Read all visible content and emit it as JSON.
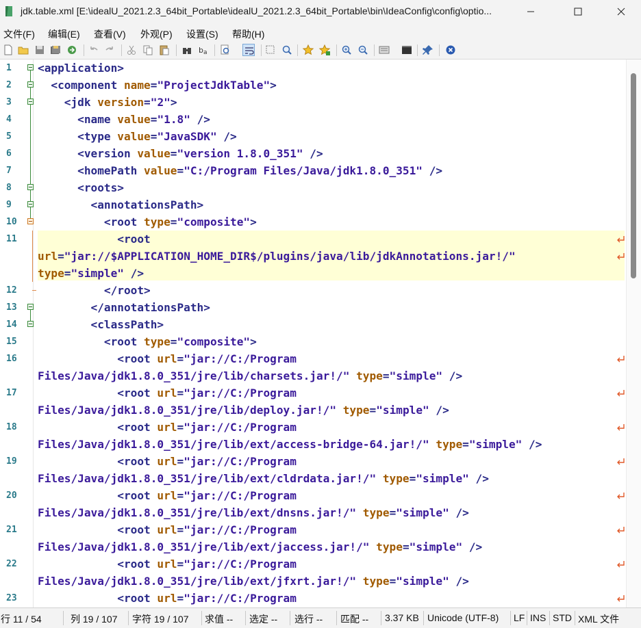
{
  "window": {
    "title": "jdk.table.xml [E:\\idealU_2021.2.3_64bit_Portable\\idealU_2021.2.3_64bit_Portable\\bin\\IdeaConfig\\config\\optio..."
  },
  "menu": [
    "文件(F)",
    "编辑(E)",
    "查看(V)",
    "外观(P)",
    "设置(S)",
    "帮助(H)"
  ],
  "toolbar_icons": [
    "new-file-icon",
    "open-folder-icon",
    "save-icon",
    "save-all-icon",
    "browse-icon",
    "undo-icon",
    "redo-icon",
    "cut-icon",
    "copy-icon",
    "paste-icon",
    "find-icon",
    "replace-icon",
    "find-in-files-icon",
    "word-wrap-icon",
    "select-all-icon",
    "zoom-find-icon",
    "favorite-icon",
    "add-favorite-icon",
    "zoom-in-icon",
    "zoom-out-icon",
    "view-icon",
    "console-icon",
    "pin-icon",
    "close-circle-icon"
  ],
  "lines": [
    {
      "num": "1",
      "code": [
        [
          "t",
          "<application>"
        ]
      ]
    },
    {
      "num": "2",
      "code": [
        [
          "t",
          "  <component "
        ],
        [
          "a",
          "name"
        ],
        [
          "t",
          "="
        ],
        [
          "v",
          "\"ProjectJdkTable\""
        ],
        [
          "t",
          ">"
        ]
      ]
    },
    {
      "num": "3",
      "code": [
        [
          "t",
          "    <jdk "
        ],
        [
          "a",
          "version"
        ],
        [
          "t",
          "="
        ],
        [
          "v",
          "\"2\""
        ],
        [
          "t",
          ">"
        ]
      ]
    },
    {
      "num": "4",
      "code": [
        [
          "t",
          "      <name "
        ],
        [
          "a",
          "value"
        ],
        [
          "t",
          "="
        ],
        [
          "v",
          "\"1.8\""
        ],
        [
          "t",
          " />"
        ]
      ]
    },
    {
      "num": "5",
      "code": [
        [
          "t",
          "      <type "
        ],
        [
          "a",
          "value"
        ],
        [
          "t",
          "="
        ],
        [
          "v",
          "\"JavaSDK\""
        ],
        [
          "t",
          " />"
        ]
      ]
    },
    {
      "num": "6",
      "code": [
        [
          "t",
          "      <version "
        ],
        [
          "a",
          "value"
        ],
        [
          "t",
          "="
        ],
        [
          "v",
          "\"version 1.8.0_351\""
        ],
        [
          "t",
          " />"
        ]
      ]
    },
    {
      "num": "7",
      "code": [
        [
          "t",
          "      <homePath "
        ],
        [
          "a",
          "value"
        ],
        [
          "t",
          "="
        ],
        [
          "v",
          "\"C:/Program Files/Java/jdk1.8.0_351\""
        ],
        [
          "t",
          " />"
        ]
      ]
    },
    {
      "num": "8",
      "code": [
        [
          "t",
          "      <roots>"
        ]
      ]
    },
    {
      "num": "9",
      "code": [
        [
          "t",
          "        <annotationsPath>"
        ]
      ]
    },
    {
      "num": "10",
      "code": [
        [
          "t",
          "          <root "
        ],
        [
          "a",
          "type"
        ],
        [
          "t",
          "="
        ],
        [
          "v",
          "\"composite\""
        ],
        [
          "t",
          ">"
        ]
      ]
    },
    {
      "num": "11",
      "code": [
        [
          "t",
          "            <root"
        ]
      ]
    },
    {
      "num": "",
      "code": [
        [
          "a",
          "url"
        ],
        [
          "t",
          "="
        ],
        [
          "v",
          "\"jar://$APPLICATION_HOME_DIR$/plugins/java/lib/jdkAnnotations.jar!/\""
        ]
      ]
    },
    {
      "num": "",
      "code": [
        [
          "a",
          "type"
        ],
        [
          "t",
          "="
        ],
        [
          "v",
          "\"simple\""
        ],
        [
          "t",
          " />"
        ]
      ]
    },
    {
      "num": "12",
      "code": [
        [
          "t",
          "          </root>"
        ]
      ]
    },
    {
      "num": "13",
      "code": [
        [
          "t",
          "        </annotationsPath>"
        ]
      ]
    },
    {
      "num": "14",
      "code": [
        [
          "t",
          "        <classPath>"
        ]
      ]
    },
    {
      "num": "15",
      "code": [
        [
          "t",
          "          <root "
        ],
        [
          "a",
          "type"
        ],
        [
          "t",
          "="
        ],
        [
          "v",
          "\"composite\""
        ],
        [
          "t",
          ">"
        ]
      ]
    },
    {
      "num": "16",
      "code": [
        [
          "t",
          "            <root "
        ],
        [
          "a",
          "url"
        ],
        [
          "t",
          "="
        ],
        [
          "v",
          "\"jar://C:/Program"
        ]
      ]
    },
    {
      "num": "",
      "code": [
        [
          "v",
          "Files/Java/jdk1.8.0_351/jre/lib/charsets.jar!/\""
        ],
        [
          "t",
          " "
        ],
        [
          "a",
          "type"
        ],
        [
          "t",
          "="
        ],
        [
          "v",
          "\"simple\""
        ],
        [
          "t",
          " />"
        ]
      ]
    },
    {
      "num": "17",
      "code": [
        [
          "t",
          "            <root "
        ],
        [
          "a",
          "url"
        ],
        [
          "t",
          "="
        ],
        [
          "v",
          "\"jar://C:/Program"
        ]
      ]
    },
    {
      "num": "",
      "code": [
        [
          "v",
          "Files/Java/jdk1.8.0_351/jre/lib/deploy.jar!/\""
        ],
        [
          "t",
          " "
        ],
        [
          "a",
          "type"
        ],
        [
          "t",
          "="
        ],
        [
          "v",
          "\"simple\""
        ],
        [
          "t",
          " />"
        ]
      ]
    },
    {
      "num": "18",
      "code": [
        [
          "t",
          "            <root "
        ],
        [
          "a",
          "url"
        ],
        [
          "t",
          "="
        ],
        [
          "v",
          "\"jar://C:/Program"
        ]
      ]
    },
    {
      "num": "",
      "code": [
        [
          "v",
          "Files/Java/jdk1.8.0_351/jre/lib/ext/access-bridge-64.jar!/\""
        ],
        [
          "t",
          " "
        ],
        [
          "a",
          "type"
        ],
        [
          "t",
          "="
        ],
        [
          "v",
          "\"simple\""
        ],
        [
          "t",
          " />"
        ]
      ]
    },
    {
      "num": "19",
      "code": [
        [
          "t",
          "            <root "
        ],
        [
          "a",
          "url"
        ],
        [
          "t",
          "="
        ],
        [
          "v",
          "\"jar://C:/Program"
        ]
      ]
    },
    {
      "num": "",
      "code": [
        [
          "v",
          "Files/Java/jdk1.8.0_351/jre/lib/ext/cldrdata.jar!/\""
        ],
        [
          "t",
          " "
        ],
        [
          "a",
          "type"
        ],
        [
          "t",
          "="
        ],
        [
          "v",
          "\"simple\""
        ],
        [
          "t",
          " />"
        ]
      ]
    },
    {
      "num": "20",
      "code": [
        [
          "t",
          "            <root "
        ],
        [
          "a",
          "url"
        ],
        [
          "t",
          "="
        ],
        [
          "v",
          "\"jar://C:/Program"
        ]
      ]
    },
    {
      "num": "",
      "code": [
        [
          "v",
          "Files/Java/jdk1.8.0_351/jre/lib/ext/dnsns.jar!/\""
        ],
        [
          "t",
          " "
        ],
        [
          "a",
          "type"
        ],
        [
          "t",
          "="
        ],
        [
          "v",
          "\"simple\""
        ],
        [
          "t",
          " />"
        ]
      ]
    },
    {
      "num": "21",
      "code": [
        [
          "t",
          "            <root "
        ],
        [
          "a",
          "url"
        ],
        [
          "t",
          "="
        ],
        [
          "v",
          "\"jar://C:/Program"
        ]
      ]
    },
    {
      "num": "",
      "code": [
        [
          "v",
          "Files/Java/jdk1.8.0_351/jre/lib/ext/jaccess.jar!/\""
        ],
        [
          "t",
          " "
        ],
        [
          "a",
          "type"
        ],
        [
          "t",
          "="
        ],
        [
          "v",
          "\"simple\""
        ],
        [
          "t",
          " />"
        ]
      ]
    },
    {
      "num": "22",
      "code": [
        [
          "t",
          "            <root "
        ],
        [
          "a",
          "url"
        ],
        [
          "t",
          "="
        ],
        [
          "v",
          "\"jar://C:/Program"
        ]
      ]
    },
    {
      "num": "",
      "code": [
        [
          "v",
          "Files/Java/jdk1.8.0_351/jre/lib/ext/jfxrt.jar!/\""
        ],
        [
          "t",
          " "
        ],
        [
          "a",
          "type"
        ],
        [
          "t",
          "="
        ],
        [
          "v",
          "\"simple\""
        ],
        [
          "t",
          " />"
        ]
      ]
    },
    {
      "num": "23",
      "code": [
        [
          "t",
          "            <root "
        ],
        [
          "a",
          "url"
        ],
        [
          "t",
          "="
        ],
        [
          "v",
          "\"jar://C:/Program"
        ]
      ]
    }
  ],
  "status": [
    "行 11 / 54",
    "列 19 / 107",
    "字符 19 / 107",
    "求值 --",
    "选定 --",
    "选行 --",
    "匹配 --",
    "3.37 KB",
    "Unicode (UTF-8)",
    "LF",
    "INS",
    "STD",
    "XML 文件"
  ],
  "colors": {
    "tag": "#2a2a88",
    "attr": "#a05a00",
    "value": "#3a1a9a",
    "highlight": "#ffffd6",
    "linenum": "#2a7a8a"
  }
}
